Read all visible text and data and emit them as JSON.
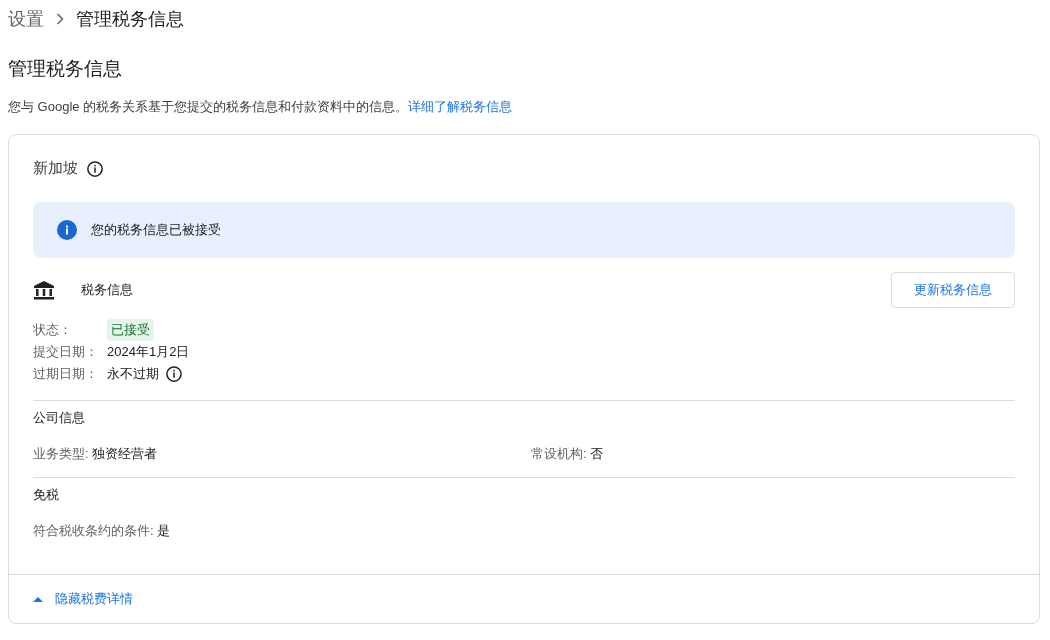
{
  "breadcrumb": [
    "设置",
    "管理税务信息"
  ],
  "page": {
    "title": "管理税务信息",
    "description": "您与 Google 的税务关系基于您提交的税务信息和付款资料中的信息。",
    "link": "详细了解税务信息"
  },
  "card": {
    "country": "新加坡",
    "notice": "您的税务信息已被接受",
    "section_title": "税务信息",
    "update_button": "更新税务信息",
    "details": [
      {
        "label": "状态：",
        "value": "已接受",
        "kind": "badge"
      },
      {
        "label": "提交日期：",
        "value": "2024年1月2日",
        "kind": "text"
      },
      {
        "label": "过期日期：",
        "value": "永不过期",
        "kind": "info"
      }
    ],
    "groups": [
      {
        "title": "公司信息",
        "fields": [
          {
            "label": "业务类型:",
            "value": "独资经营者"
          },
          {
            "label": "常设机构:",
            "value": "否"
          }
        ]
      },
      {
        "title": "免税",
        "fields": [
          {
            "label": "符合税收条约的条件:",
            "value": "是"
          }
        ]
      }
    ],
    "toggle": {
      "label": "隐藏税费详情",
      "expanded": true
    }
  }
}
